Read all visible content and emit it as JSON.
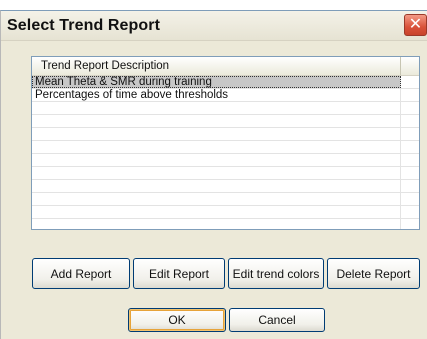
{
  "dialog": {
    "title": "Select Trend Report"
  },
  "icons": {
    "close": "close-icon"
  },
  "list": {
    "header": "Trend Report Description",
    "rows": [
      "Mean Theta & SMR during training",
      "Percentages of time above thresholds",
      "",
      "",
      "",
      "",
      "",
      "",
      "",
      "",
      "",
      "",
      ""
    ],
    "selected_index": 0
  },
  "buttons": {
    "add_report": "Add Report",
    "edit_report": "Edit Report",
    "edit_trend_colors": "Edit trend colors",
    "delete_report": "Delete Report",
    "ok": "OK",
    "cancel": "Cancel"
  },
  "colors": {
    "window_bg": "#ece9d8",
    "selection": "#c7c7c7",
    "button_border": "#003c74",
    "close_red": "#d9523a",
    "default_button_highlight": "#e6a33a"
  }
}
